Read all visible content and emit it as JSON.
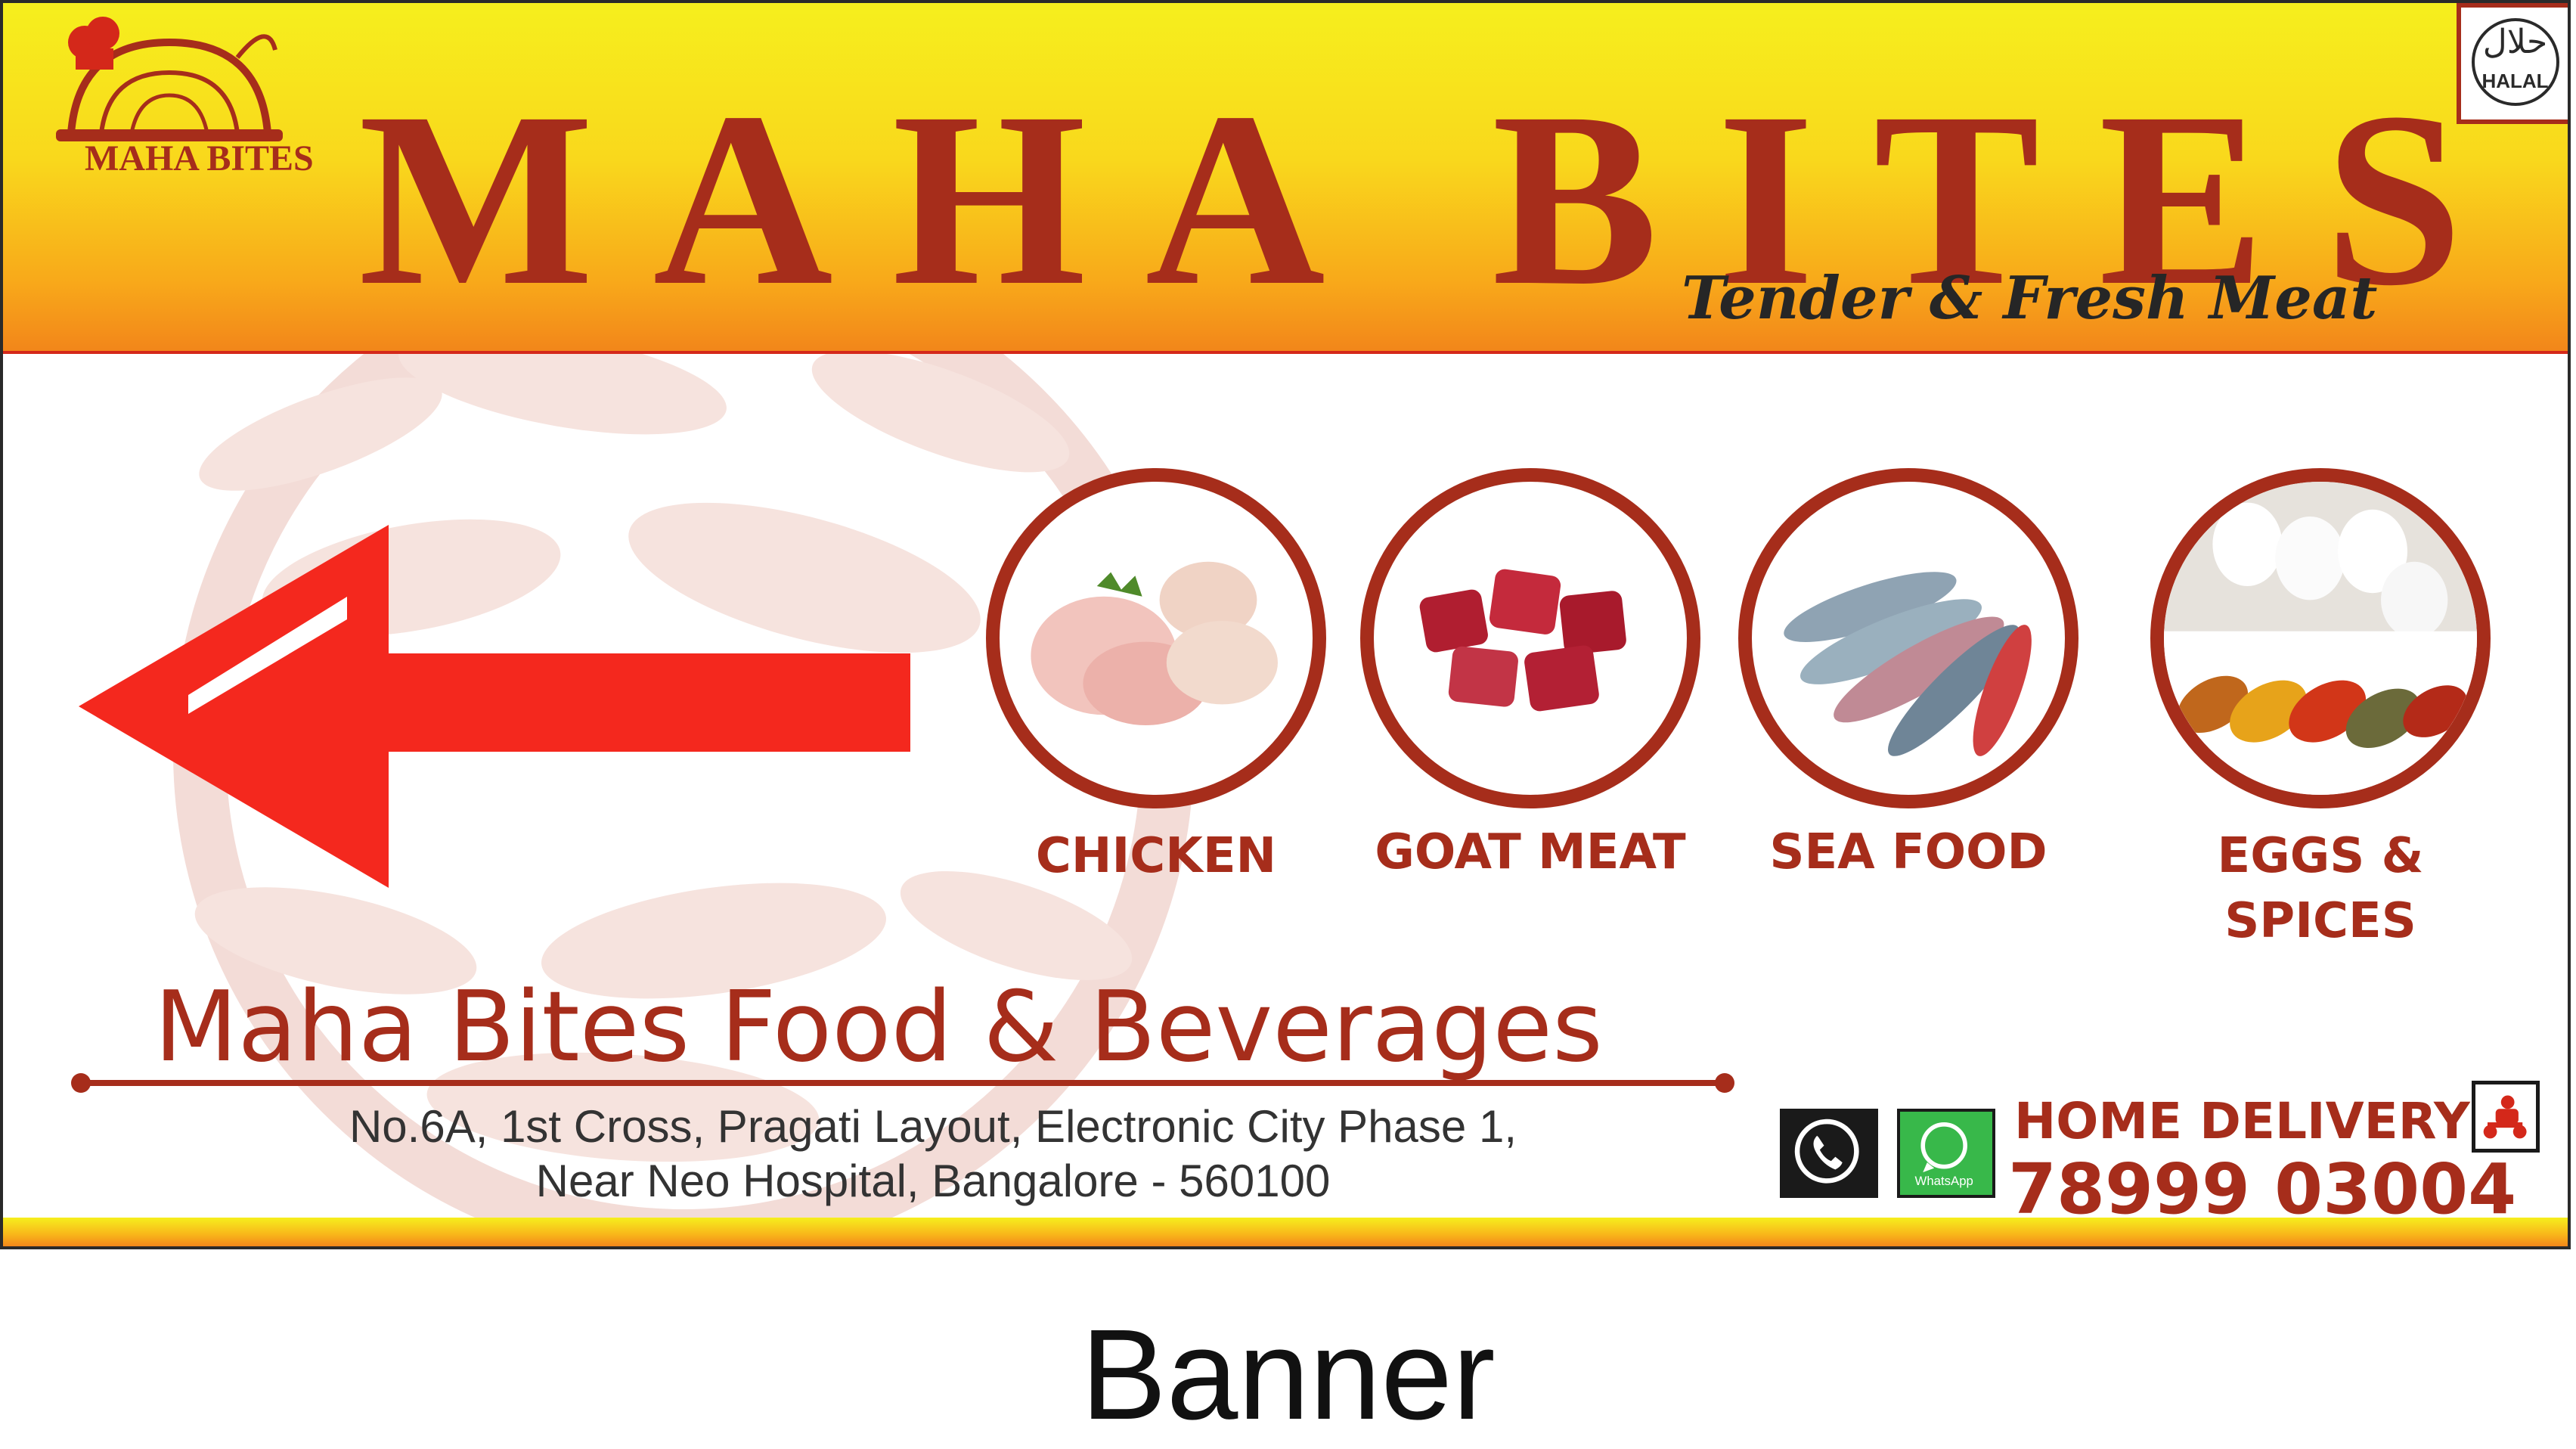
{
  "brand": {
    "title": "MAHA BITES",
    "tagline": "Tender & Fresh Meat",
    "logo_text": "MAHA BITES",
    "halal_arabic": "حلال",
    "halal_text": "HALAL",
    "primary_color": "#a62d1b",
    "header_gradient": [
      "#f6ef1d",
      "#f2861a"
    ],
    "arrow_color": "#f4281e"
  },
  "categories": [
    {
      "label": "CHICKEN",
      "icon": "chicken-image"
    },
    {
      "label": "GOAT MEAT",
      "icon": "goat-meat-image"
    },
    {
      "label": "SEA FOOD",
      "icon": "sea-food-image"
    },
    {
      "label": "EGGS &\nSPICES",
      "icon": "eggs-spices-image"
    }
  ],
  "company": {
    "name": "Maha Bites Food & Beverages",
    "address_line1": "No.6A, 1st Cross, Pragati Layout, Electronic City Phase 1,",
    "address_line2": "Near Neo Hospital, Bangalore - 560100"
  },
  "contact": {
    "delivery_label": "HOME DELIVERY",
    "phone": "78999 03004",
    "whatsapp_label": "WhatsApp"
  },
  "caption": "Banner"
}
